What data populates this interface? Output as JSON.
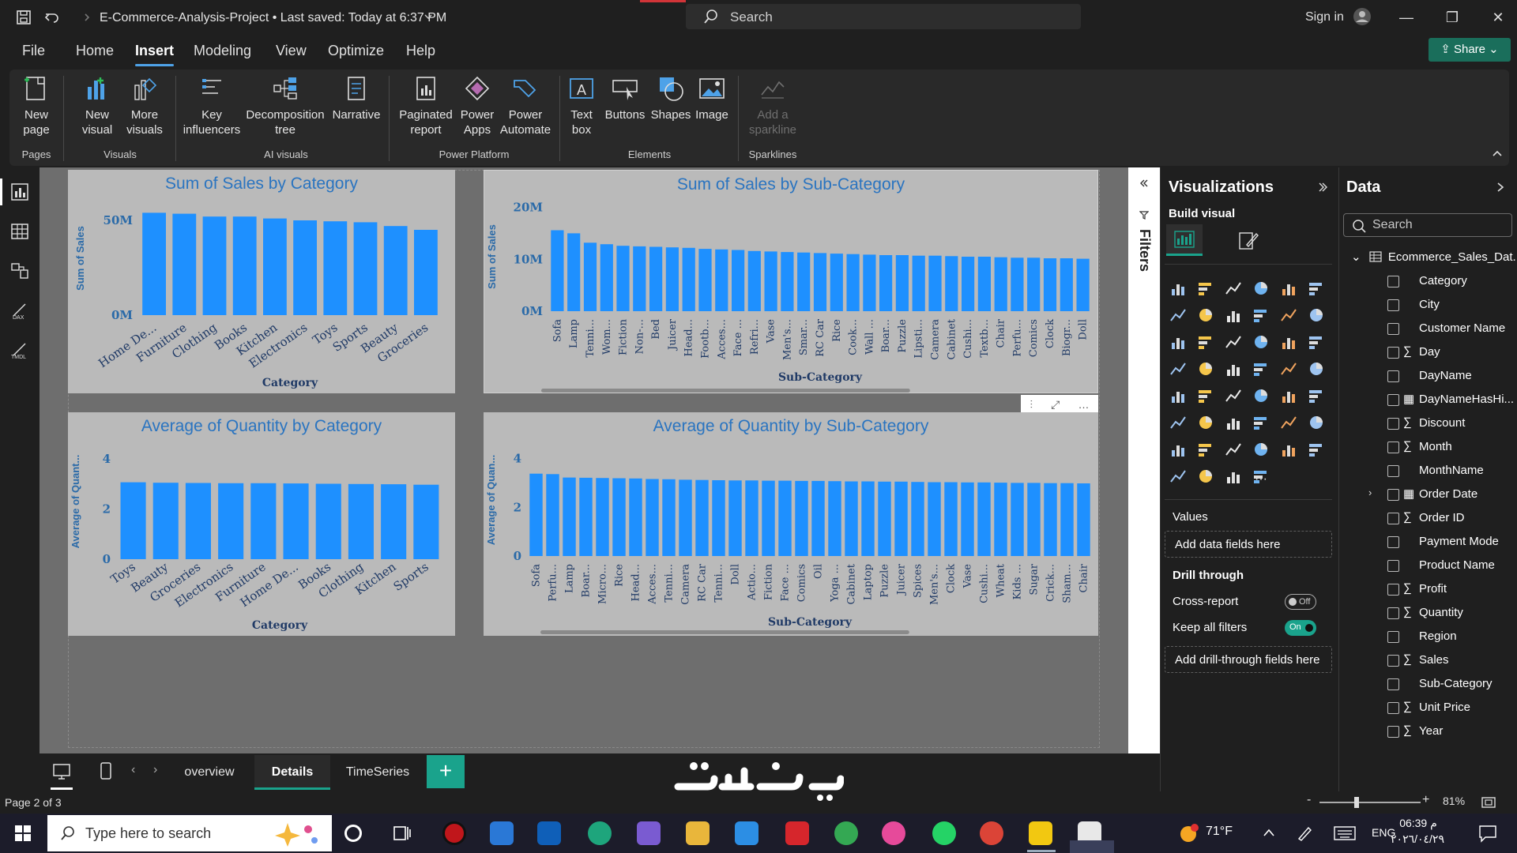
{
  "titlebar": {
    "doc_title": "E-Commerce-Analysis-Project • Last saved: Today at 6:37 PM",
    "search_label": "Search",
    "signin_label": "Sign in",
    "minimize": "—",
    "restore": "❐",
    "close": "✕"
  },
  "menu": {
    "items": [
      "File",
      "Home",
      "Insert",
      "Modeling",
      "View",
      "Optimize",
      "Help"
    ],
    "active": "Insert",
    "share_label": "Share"
  },
  "ribbon": {
    "buttons": {
      "new_page": "New page",
      "new_visual": "New visual",
      "more_visuals": "More visuals",
      "key_influencers": "Key influencers",
      "decomposition_tree": "Decomposition tree",
      "narrative": "Narrative",
      "paginated_report": "Paginated report",
      "power_apps": "Power Apps",
      "power_automate": "Power Automate",
      "text_box": "Text box",
      "buttons": "Buttons",
      "shapes": "Shapes",
      "image": "Image",
      "add_sparkline": "Add a sparkline"
    },
    "groups": {
      "pages": "Pages",
      "visuals": "Visuals",
      "ai_visuals": "AI visuals",
      "power_platform": "Power Platform",
      "elements": "Elements",
      "sparklines": "Sparklines"
    }
  },
  "colors": {
    "bar": "#1e90ff",
    "title": "#2a74c0",
    "accent": "#1aa38c",
    "visual_bg": "#bababa",
    "canvas_bg": "#6e6e6e"
  },
  "chart_data": [
    {
      "type": "bar",
      "title": "Sum of Sales by Category",
      "xlabel": "Category",
      "ylabel": "Sum of Sales",
      "yticks": [
        "0M",
        "50M"
      ],
      "ylim": [
        0,
        60
      ],
      "categories": [
        "Home De...",
        "Furniture",
        "Clothing",
        "Books",
        "Kitchen",
        "Electronics",
        "Toys",
        "Sports",
        "Beauty",
        "Groceries"
      ],
      "values": [
        54,
        53.5,
        52,
        52,
        51,
        50,
        49.5,
        49,
        47,
        45
      ]
    },
    {
      "type": "bar",
      "title": "Sum of Sales by Sub-Category",
      "xlabel": "Sub-Category",
      "ylabel": "Sum of Sales",
      "yticks": [
        "0M",
        "10M",
        "20M"
      ],
      "ylim": [
        0,
        21
      ],
      "categories": [
        "Sofa",
        "Lamp",
        "Tenni...",
        "Wom...",
        "Fiction",
        "Non-...",
        "Bed",
        "Juicer",
        "Head...",
        "Footb...",
        "Acces...",
        "Face ...",
        "Refri...",
        "Vase",
        "Men's...",
        "Smar...",
        "RC Car",
        "Rice",
        "Cook...",
        "Wall ...",
        "Boar...",
        "Puzzle",
        "Lipsti...",
        "Camera",
        "Cabinet",
        "Cushi...",
        "Textb...",
        "Chair",
        "Perfu...",
        "Comics",
        "Clock",
        "Biogr...",
        "Doll"
      ],
      "values": [
        15.6,
        15,
        13.2,
        12.9,
        12.6,
        12.5,
        12.4,
        12.3,
        12.2,
        12.0,
        11.9,
        11.8,
        11.6,
        11.5,
        11.4,
        11.3,
        11.2,
        11.1,
        11.0,
        10.9,
        10.8,
        10.8,
        10.7,
        10.7,
        10.6,
        10.5,
        10.5,
        10.4,
        10.3,
        10.3,
        10.2,
        10.2,
        10.1
      ]
    },
    {
      "type": "bar",
      "title": "Average of Quantity by Category",
      "xlabel": "Category",
      "ylabel": "Average of Quant...",
      "yticks": [
        "0",
        "2",
        "4"
      ],
      "ylim": [
        0,
        4.6
      ],
      "categories": [
        "Toys",
        "Beauty",
        "Groceries",
        "Electronics",
        "Furniture",
        "Home De...",
        "Books",
        "Clothing",
        "Kitchen",
        "Sports"
      ],
      "values": [
        3.07,
        3.05,
        3.04,
        3.03,
        3.03,
        3.02,
        3.01,
        3.0,
        2.99,
        2.97
      ]
    },
    {
      "type": "bar",
      "title": "Average of Quantity by Sub-Category",
      "xlabel": "Sub-Category",
      "ylabel": "Average of Quan...",
      "yticks": [
        "0",
        "2",
        "4"
      ],
      "ylim": [
        0,
        4.6
      ],
      "categories": [
        "Sofa",
        "Perfu...",
        "Lamp",
        "Boar...",
        "Micro...",
        "Rice",
        "Head...",
        "Acces...",
        "Tenni...",
        "Camera",
        "RC Car",
        "Tenni...",
        "Doll",
        "Actio...",
        "Fiction",
        "Face ...",
        "Comics",
        "Oil",
        "Yoga ...",
        "Cabinet",
        "Laptop",
        "Puzzle",
        "Juicer",
        "Spices",
        "Men's...",
        "Clock",
        "Vase",
        "Cushi...",
        "Wheat",
        "Kids ...",
        "Sugar",
        "Crick...",
        "Sham...",
        "Chair"
      ],
      "values": [
        3.38,
        3.36,
        3.22,
        3.21,
        3.2,
        3.19,
        3.18,
        3.16,
        3.15,
        3.13,
        3.12,
        3.11,
        3.1,
        3.1,
        3.09,
        3.09,
        3.08,
        3.08,
        3.07,
        3.06,
        3.06,
        3.05,
        3.05,
        3.04,
        3.03,
        3.03,
        3.02,
        3.02,
        3.01,
        3.0,
        3.0,
        2.99,
        2.99,
        2.98
      ]
    }
  ],
  "filters": {
    "label": "Filters"
  },
  "visualizations": {
    "title": "Visualizations",
    "build_visual": "Build visual",
    "values_label": "Values",
    "values_well": "Add data fields here",
    "drill_through": "Drill through",
    "cross_report": "Cross-report",
    "cross_report_state": "Off",
    "keep_all_filters": "Keep all filters",
    "keep_all_filters_state": "On",
    "drill_well": "Add drill-through fields here",
    "more": "···"
  },
  "data_pane": {
    "title": "Data",
    "search_placeholder": "Search",
    "table_name": "Ecommerce_Sales_Dat...",
    "fields": [
      {
        "name": "Category",
        "sigma": ""
      },
      {
        "name": "City",
        "sigma": ""
      },
      {
        "name": "Customer Name",
        "sigma": ""
      },
      {
        "name": "Day",
        "sigma": "∑"
      },
      {
        "name": "DayName",
        "sigma": ""
      },
      {
        "name": "DayNameHasHi...",
        "sigma": "▦"
      },
      {
        "name": "Discount",
        "sigma": "∑"
      },
      {
        "name": "Month",
        "sigma": "∑"
      },
      {
        "name": "MonthName",
        "sigma": ""
      },
      {
        "name": "Order Date",
        "sigma": "▦"
      },
      {
        "name": "Order ID",
        "sigma": "∑"
      },
      {
        "name": "Payment Mode",
        "sigma": ""
      },
      {
        "name": "Product Name",
        "sigma": ""
      },
      {
        "name": "Profit",
        "sigma": "∑"
      },
      {
        "name": "Quantity",
        "sigma": "∑"
      },
      {
        "name": "Region",
        "sigma": ""
      },
      {
        "name": "Sales",
        "sigma": "∑"
      },
      {
        "name": "Sub-Category",
        "sigma": ""
      },
      {
        "name": "Unit Price",
        "sigma": "∑"
      },
      {
        "name": "Year",
        "sigma": "∑"
      }
    ]
  },
  "pages": {
    "tabs": [
      "overview",
      "Details",
      "TimeSeries"
    ],
    "active": "Details",
    "add": "+"
  },
  "status": {
    "page_of": "Page 2 of 3",
    "zoom": "81%",
    "zoom_minus": "-",
    "zoom_plus": "+"
  },
  "taskbar": {
    "search_placeholder": "Type here to search",
    "temperature": "71°F",
    "language": "ENG",
    "time": "06:39 م",
    "date": "٢٠٢٦/٠٤/٢٩"
  }
}
